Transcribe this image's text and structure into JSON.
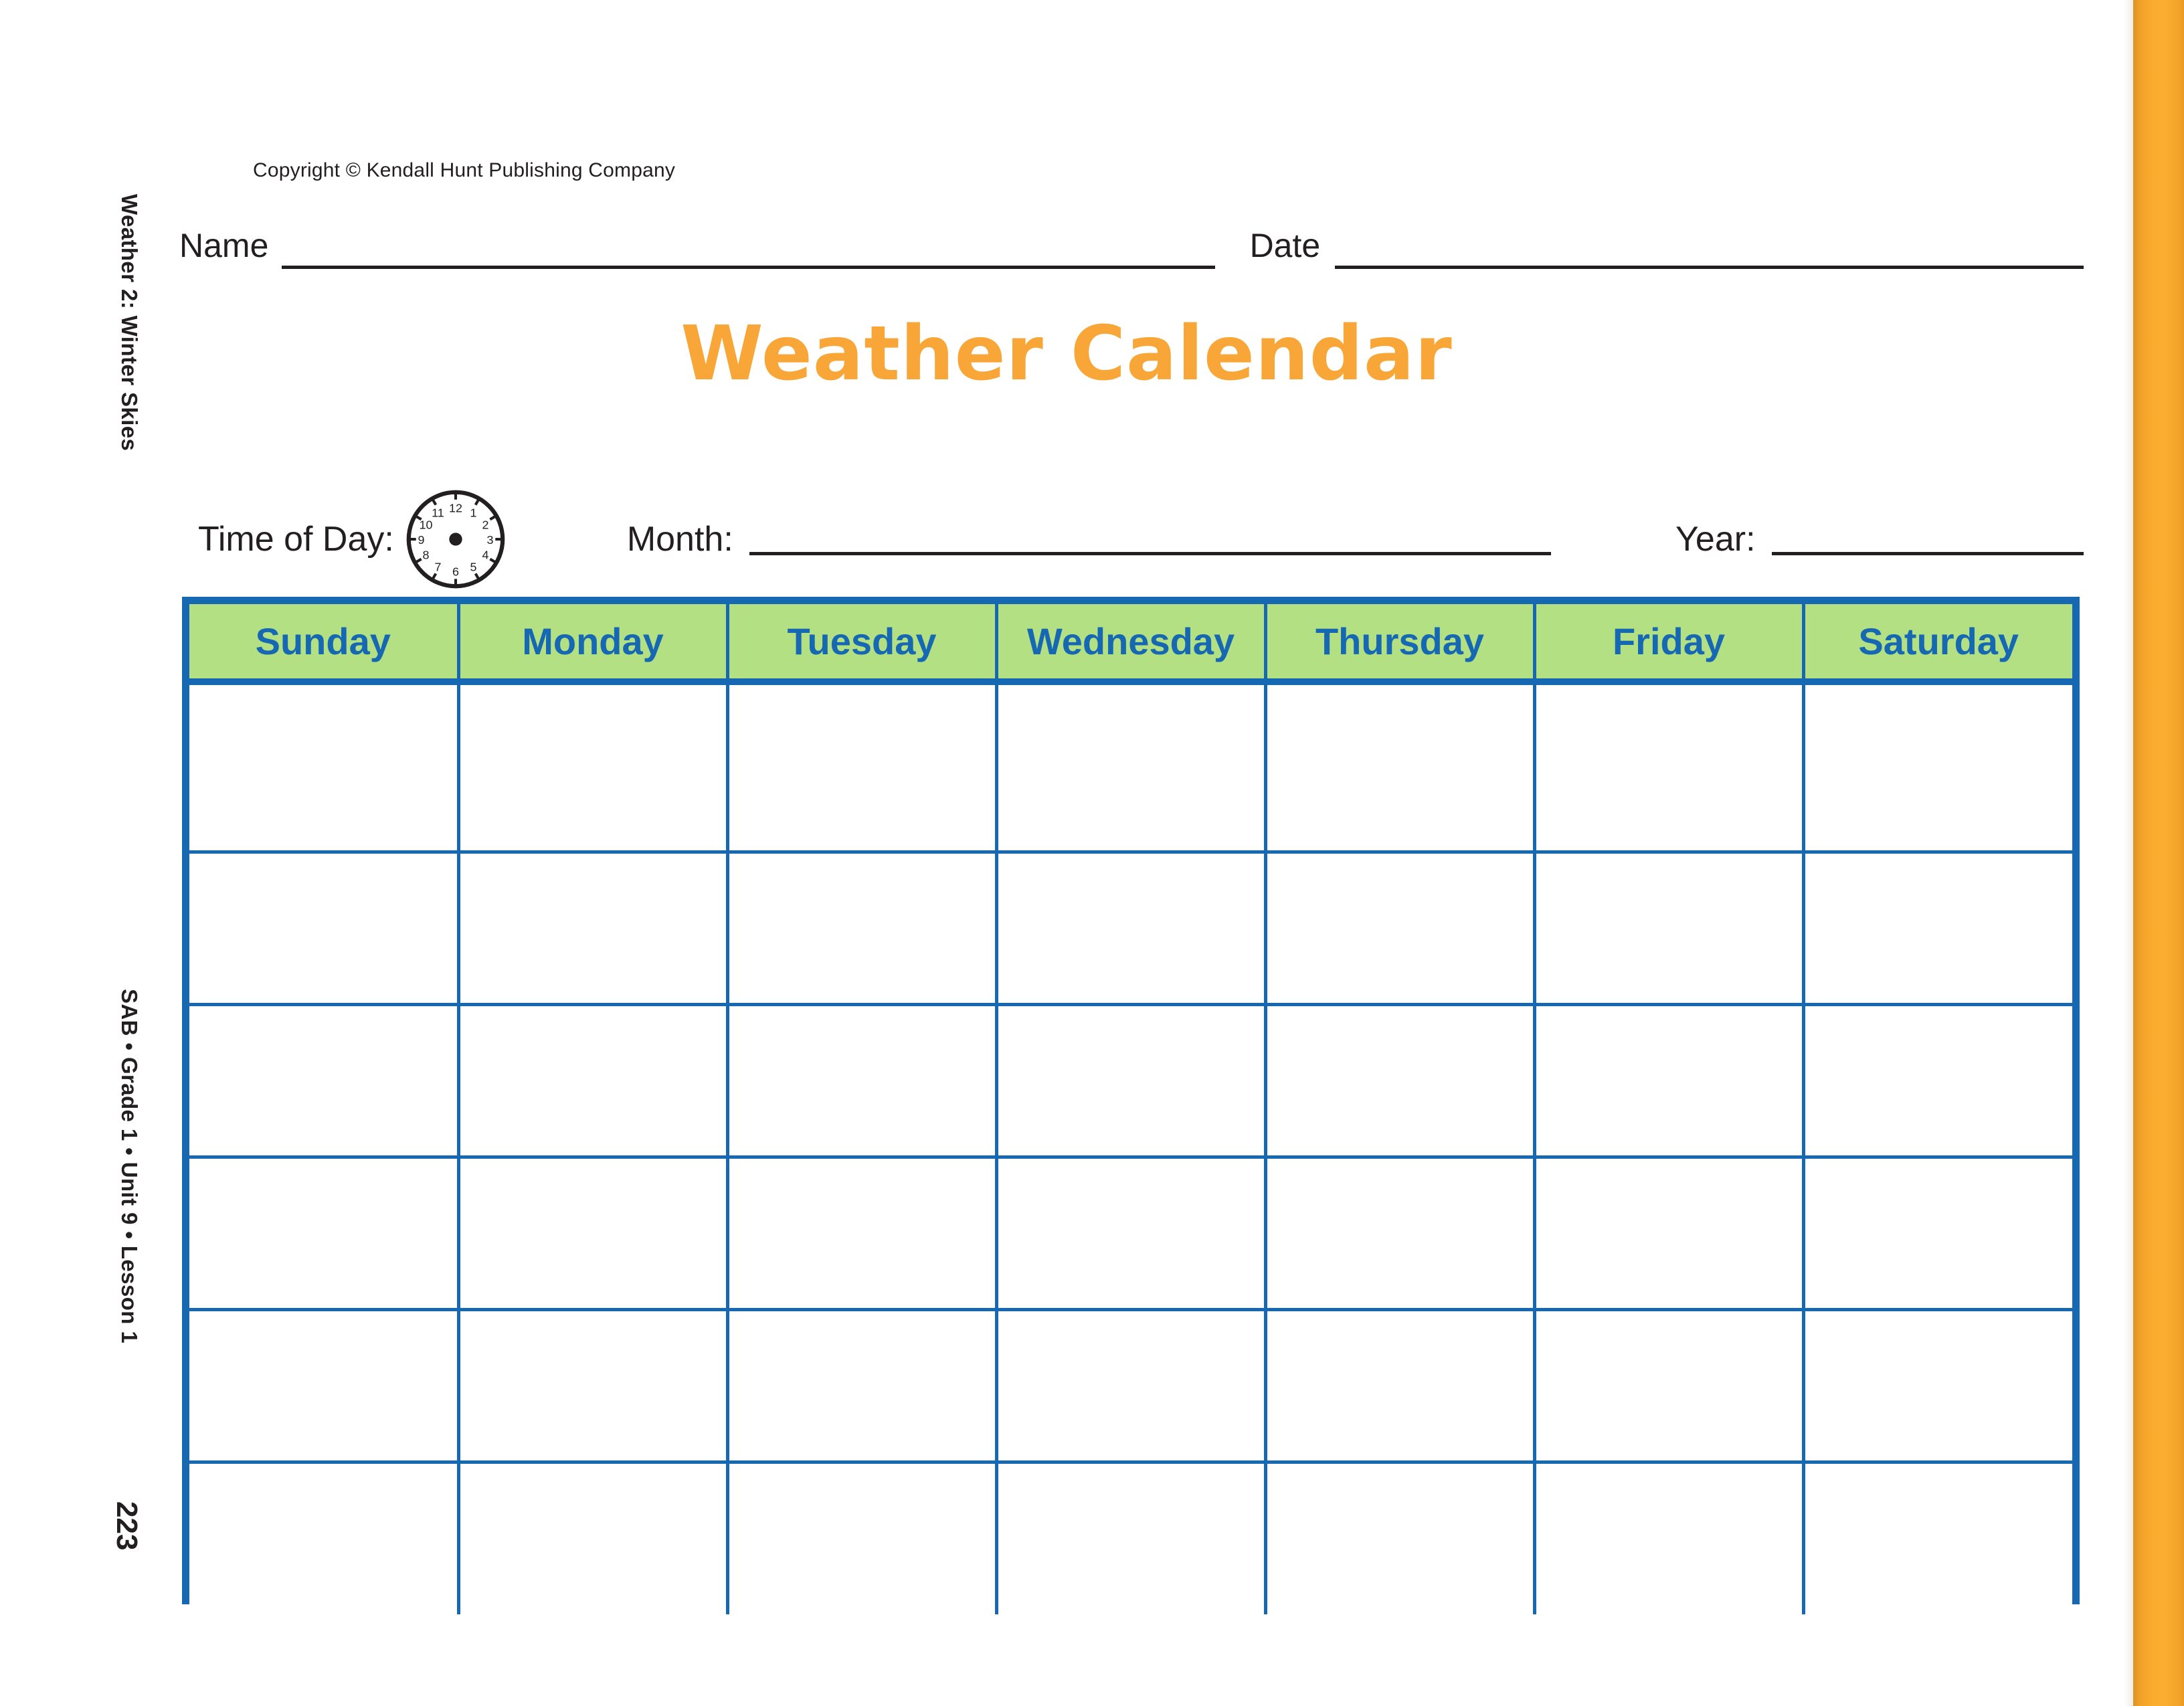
{
  "page": {
    "copyright": "Copyright © Kendall Hunt Publishing Company",
    "title": "Weather Calendar",
    "page_number": "223",
    "side_unit_title": "Weather 2: Winter Skies",
    "side_meta": "SAB • Grade 1 • Unit 9 • Lesson 1"
  },
  "fields": {
    "name_label": "Name",
    "date_label": "Date",
    "time_of_day_label": "Time of Day:",
    "month_label": "Month:",
    "year_label": "Year:",
    "name_value": "",
    "date_value": "",
    "month_value": "",
    "year_value": ""
  },
  "clock": {
    "hours": [
      "12",
      "1",
      "2",
      "3",
      "4",
      "5",
      "6",
      "7",
      "8",
      "9",
      "10",
      "11"
    ],
    "hands": "none",
    "center_dot": true
  },
  "calendar": {
    "day_headers": [
      "Sunday",
      "Monday",
      "Tuesday",
      "Wednesday",
      "Thursday",
      "Friday",
      "Saturday"
    ],
    "week_rows": 6,
    "cells": [
      [
        "",
        "",
        "",
        "",
        "",
        "",
        ""
      ],
      [
        "",
        "",
        "",
        "",
        "",
        "",
        ""
      ],
      [
        "",
        "",
        "",
        "",
        "",
        "",
        ""
      ],
      [
        "",
        "",
        "",
        "",
        "",
        "",
        ""
      ],
      [
        "",
        "",
        "",
        "",
        "",
        "",
        ""
      ],
      [
        "",
        "",
        "",
        "",
        "",
        "",
        ""
      ]
    ]
  },
  "colors": {
    "title_orange": "#f9a638",
    "header_green": "#b4e084",
    "grid_blue": "#1668b3",
    "text_black": "#231f20",
    "edge_strip_orange": "#faae31"
  }
}
